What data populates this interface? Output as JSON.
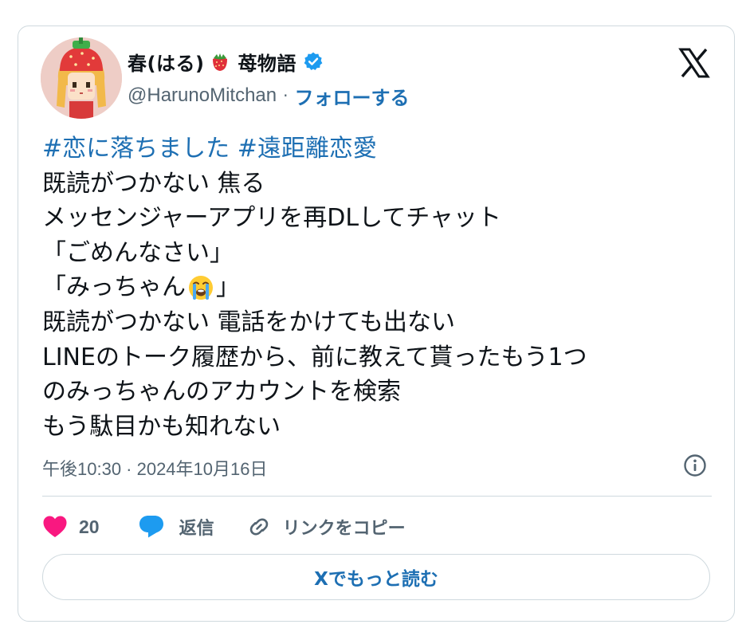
{
  "author": {
    "name_part1": "春(はる)",
    "name_part2": "苺物語",
    "handle": "@HarunoMitchan",
    "separator": "·",
    "follow_label": "フォローする",
    "verified": true
  },
  "post": {
    "hashtags": [
      "#恋に落ちました",
      "#遠距離恋愛"
    ],
    "lines": [
      "既読がつかない 焦る",
      "メッセンジャーアプリを再DLしてチャット",
      "「ごめんなさい」",
      "「みっちゃん",
      "」",
      "既読がつかない 電話をかけても出ない",
      "LINEのトーク履歴から、前に教えて貰ったもう1つ",
      "のみっちゃんのアカウントを検索",
      "もう駄目かも知れない"
    ],
    "timestamp": "午後10:30 · 2024年10月16日"
  },
  "actions": {
    "like_count": "20",
    "reply_label": "返信",
    "copy_link_label": "リンクをコピー"
  },
  "read_more_label": "Xでもっと読む",
  "colors": {
    "link": "#1d6fb3",
    "secondary_text": "#536471",
    "like": "#f91880",
    "reply": "#1d9bf0",
    "verified": "#1d9bf0",
    "border": "#cfd9de"
  },
  "icons": [
    "strawberry-emoji",
    "verified-badge-icon",
    "x-logo-icon",
    "crying-face-emoji",
    "info-icon",
    "heart-icon",
    "reply-bubble-icon",
    "link-icon"
  ]
}
